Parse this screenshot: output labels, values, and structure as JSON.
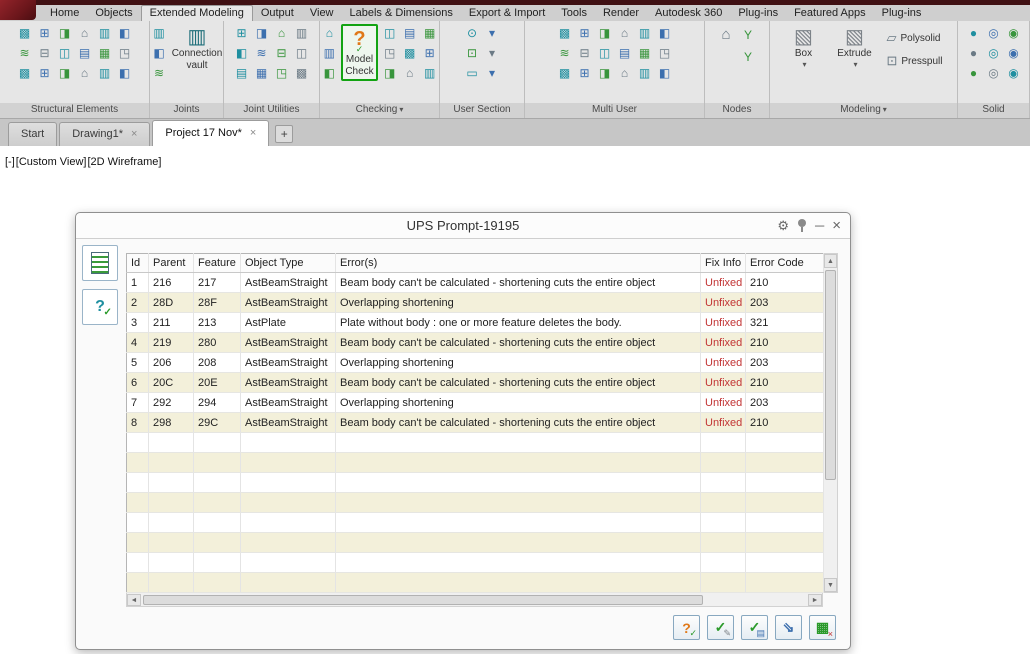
{
  "app": {
    "menu_tabs": [
      "Home",
      "Objects",
      "Extended Modeling",
      "Output",
      "View",
      "Labels & Dimensions",
      "Export & Import",
      "Tools",
      "Render",
      "Autodesk 360",
      "Plug-ins",
      "Featured Apps",
      "Plug-ins"
    ],
    "active_menu_tab": "Extended Modeling",
    "panels": [
      {
        "label": "Structural Elements",
        "dropdown": false
      },
      {
        "label": "Joints",
        "dropdown": false
      },
      {
        "label": "Joint Utilities",
        "dropdown": false
      },
      {
        "label": "Checking",
        "dropdown": true
      },
      {
        "label": "User Section",
        "dropdown": false
      },
      {
        "label": "Multi User",
        "dropdown": false
      },
      {
        "label": "Nodes",
        "dropdown": false
      },
      {
        "label": "Modeling",
        "dropdown": true
      },
      {
        "label": "Solid",
        "dropdown": false
      }
    ],
    "buttons": {
      "connection_vault": "Connection vault",
      "model_check": "Model Check",
      "box": "Box",
      "extrude": "Extrude",
      "polysolid": "Polysolid",
      "presspull": "Presspull"
    },
    "grids": {
      "structural": {
        "rows": 3,
        "cols": 6
      },
      "joints": {
        "rows": 3,
        "cols": 1
      },
      "joint_utilities": {
        "rows": 3,
        "cols": 4
      },
      "checking_left": {
        "rows": 3,
        "cols": 1
      },
      "checking_right": {
        "rows": 3,
        "cols": 3
      },
      "user_section": {
        "rows": 3,
        "cols": 2,
        "glyphs": [
          "⊙",
          "▾",
          "▭",
          "▾",
          "⊡",
          "▾"
        ]
      },
      "multi_user": {
        "rows": 3,
        "cols": 6
      },
      "solid": {
        "rows": 3,
        "cols": 3,
        "glyphs": [
          "◉",
          "◎",
          "●"
        ]
      }
    },
    "icon_glyphs": [
      "▦",
      "⌂",
      "◫",
      "⊞",
      "≋",
      "◳",
      "▥",
      "▤",
      "◨",
      "⊟",
      "▩",
      "◧"
    ]
  },
  "doc_tabs": {
    "tabs": [
      {
        "label": "Start",
        "active": false,
        "closable": false
      },
      {
        "label": "Drawing1*",
        "active": false,
        "closable": true
      },
      {
        "label": "Project 17 Nov*",
        "active": true,
        "closable": true
      }
    ],
    "add_label": "+"
  },
  "viewport": {
    "controls": "[-]",
    "view_name": "[Custom View]",
    "visual_style": "[2D Wireframe]"
  },
  "dialog": {
    "title": "UPS Prompt-19195",
    "columns": [
      "Id",
      "Parent",
      "Feature",
      "Object Type",
      "Error(s)",
      "Fix Info",
      "Error Code"
    ],
    "fix_color": "#c23434",
    "rows": [
      {
        "id": "1",
        "parent": "216",
        "feature": "217",
        "object_type": "AstBeamStraight",
        "error": "Beam body can't be calculated - shortening cuts the entire object",
        "fix_info": "Unfixed",
        "error_code": "210"
      },
      {
        "id": "2",
        "parent": "28D",
        "feature": "28F",
        "object_type": "AstBeamStraight",
        "error": "Overlapping shortening",
        "fix_info": "Unfixed",
        "error_code": "203"
      },
      {
        "id": "3",
        "parent": "211",
        "feature": "213",
        "object_type": "AstPlate",
        "error": "Plate without body : one or more feature deletes the body.",
        "fix_info": "Unfixed",
        "error_code": "321"
      },
      {
        "id": "4",
        "parent": "219",
        "feature": "280",
        "object_type": "AstBeamStraight",
        "error": "Beam body can't be calculated - shortening cuts the entire object",
        "fix_info": "Unfixed",
        "error_code": "210"
      },
      {
        "id": "5",
        "parent": "206",
        "feature": "208",
        "object_type": "AstBeamStraight",
        "error": "Overlapping shortening",
        "fix_info": "Unfixed",
        "error_code": "203"
      },
      {
        "id": "6",
        "parent": "20C",
        "feature": "20E",
        "object_type": "AstBeamStraight",
        "error": "Beam body can't be calculated - shortening cuts the entire object",
        "fix_info": "Unfixed",
        "error_code": "210"
      },
      {
        "id": "7",
        "parent": "292",
        "feature": "294",
        "object_type": "AstBeamStraight",
        "error": "Overlapping shortening",
        "fix_info": "Unfixed",
        "error_code": "203"
      },
      {
        "id": "8",
        "parent": "298",
        "feature": "29C",
        "object_type": "AstBeamStraight",
        "error": "Beam body can't be calculated - shortening cuts the entire object",
        "fix_info": "Unfixed",
        "error_code": "210"
      }
    ],
    "empty_row_count": 8
  },
  "icons": {
    "gear": "⚙",
    "minimize": "─",
    "close": "×",
    "tab_close": "×",
    "dropdown": "▾",
    "question": "?",
    "check": "✓",
    "cube": "▧",
    "vault": "▥",
    "house": "⌂",
    "node_y": "Y",
    "arrow_se": "⇘",
    "grid": "▦",
    "doc": "▤",
    "pencil": "✎",
    "polysolid": "▱",
    "presspull": "⊡",
    "scroll_up": "▲",
    "scroll_down": "▼",
    "scroll_left": "◄",
    "scroll_right": "►"
  }
}
